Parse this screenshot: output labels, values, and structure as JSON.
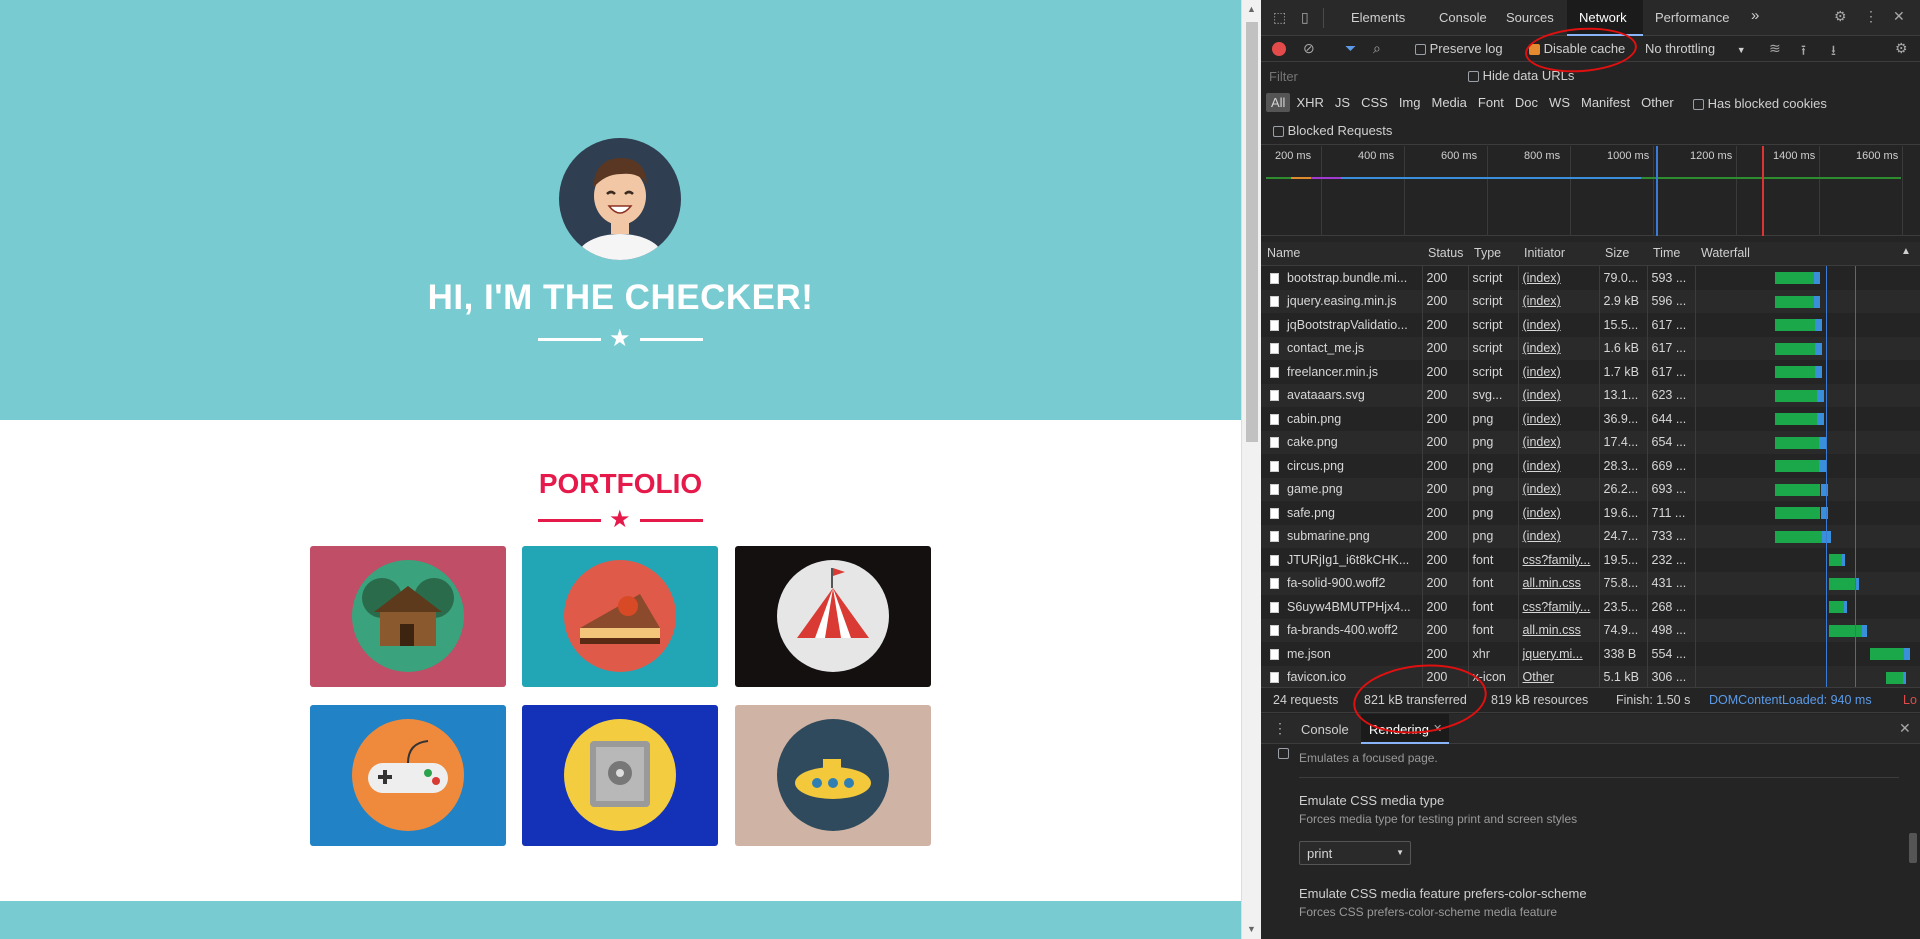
{
  "site": {
    "hero_title": "HI, I'M THE CHECKER!",
    "portfolio_title": "PORTFOLIO",
    "tiles": [
      {
        "name": "cabin",
        "bg": "#bf4e66"
      },
      {
        "name": "cake",
        "bg": "#22a5b5"
      },
      {
        "name": "circus",
        "bg": "#141010"
      },
      {
        "name": "game",
        "bg": "#2183c5"
      },
      {
        "name": "safe",
        "bg": "#1432b8"
      },
      {
        "name": "submarine",
        "bg": "#cfb3a4"
      }
    ],
    "colors": {
      "primary": "#78ccd1",
      "accent": "#e6194b"
    }
  },
  "devtools": {
    "tabs": [
      "Elements",
      "Console",
      "Sources",
      "Network",
      "Performance"
    ],
    "more_tabs": "»",
    "active_tab": "Network",
    "toolbar": {
      "preserve_log": "Preserve log",
      "disable_cache": "Disable cache",
      "throttling": "No throttling"
    },
    "filter": {
      "placeholder": "Filter",
      "hide_data_urls": "Hide data URLs",
      "types": [
        "All",
        "XHR",
        "JS",
        "CSS",
        "Img",
        "Media",
        "Font",
        "Doc",
        "WS",
        "Manifest",
        "Other"
      ],
      "has_blocked_cookies": "Has blocked cookies",
      "blocked_requests": "Blocked Requests"
    },
    "timeline_ticks": [
      "200 ms",
      "400 ms",
      "600 ms",
      "800 ms",
      "1000 ms",
      "1200 ms",
      "1400 ms",
      "1600 ms"
    ],
    "columns": [
      "Name",
      "Status",
      "Type",
      "Initiator",
      "Size",
      "Time",
      "Waterfall"
    ],
    "rows": [
      {
        "name": "bootstrap.bundle.mi...",
        "status": "200",
        "type": "script",
        "initiator": "(index)",
        "size": "79.0...",
        "time": "593 ...",
        "wf": [
          0.34,
          0.56
        ]
      },
      {
        "name": "jquery.easing.min.js",
        "status": "200",
        "type": "script",
        "initiator": "(index)",
        "size": "2.9 kB",
        "time": "596 ...",
        "wf": [
          0.34,
          0.56
        ]
      },
      {
        "name": "jqBootstrapValidatio...",
        "status": "200",
        "type": "script",
        "initiator": "(index)",
        "size": "15.5...",
        "time": "617 ...",
        "wf": [
          0.34,
          0.57
        ]
      },
      {
        "name": "contact_me.js",
        "status": "200",
        "type": "script",
        "initiator": "(index)",
        "size": "1.6 kB",
        "time": "617 ...",
        "wf": [
          0.34,
          0.57
        ]
      },
      {
        "name": "freelancer.min.js",
        "status": "200",
        "type": "script",
        "initiator": "(index)",
        "size": "1.7 kB",
        "time": "617 ...",
        "wf": [
          0.34,
          0.57
        ]
      },
      {
        "name": "avataaars.svg",
        "status": "200",
        "type": "svg...",
        "initiator": "(index)",
        "size": "13.1...",
        "time": "623 ...",
        "wf": [
          0.34,
          0.58
        ]
      },
      {
        "name": "cabin.png",
        "status": "200",
        "type": "png",
        "initiator": "(index)",
        "size": "36.9...",
        "time": "644 ...",
        "wf": [
          0.34,
          0.58
        ]
      },
      {
        "name": "cake.png",
        "status": "200",
        "type": "png",
        "initiator": "(index)",
        "size": "17.4...",
        "time": "654 ...",
        "wf": [
          0.34,
          0.59
        ]
      },
      {
        "name": "circus.png",
        "status": "200",
        "type": "png",
        "initiator": "(index)",
        "size": "28.3...",
        "time": "669 ...",
        "wf": [
          0.34,
          0.59
        ]
      },
      {
        "name": "game.png",
        "status": "200",
        "type": "png",
        "initiator": "(index)",
        "size": "26.2...",
        "time": "693 ...",
        "wf": [
          0.34,
          0.6
        ]
      },
      {
        "name": "safe.png",
        "status": "200",
        "type": "png",
        "initiator": "(index)",
        "size": "19.6...",
        "time": "711 ...",
        "wf": [
          0.34,
          0.6
        ]
      },
      {
        "name": "submarine.png",
        "status": "200",
        "type": "png",
        "initiator": "(index)",
        "size": "24.7...",
        "time": "733 ...",
        "wf": [
          0.34,
          0.61
        ]
      },
      {
        "name": "JTURjIg1_i6t8kCHK...",
        "status": "200",
        "type": "font",
        "initiator": "css?family...",
        "size": "19.5...",
        "time": "232 ...",
        "wf": [
          0.6,
          0.68
        ]
      },
      {
        "name": "fa-solid-900.woff2",
        "status": "200",
        "type": "font",
        "initiator": "all.min.css",
        "size": "75.8...",
        "time": "431 ...",
        "wf": [
          0.6,
          0.75
        ]
      },
      {
        "name": "S6uyw4BMUTPHjx4...",
        "status": "200",
        "type": "font",
        "initiator": "css?family...",
        "size": "23.5...",
        "time": "268 ...",
        "wf": [
          0.6,
          0.69
        ]
      },
      {
        "name": "fa-brands-400.woff2",
        "status": "200",
        "type": "font",
        "initiator": "all.min.css",
        "size": "74.9...",
        "time": "498 ...",
        "wf": [
          0.6,
          0.79
        ]
      },
      {
        "name": "me.json",
        "status": "200",
        "type": "xhr",
        "initiator": "jquery.mi...",
        "size": "338 B",
        "time": "554 ...",
        "wf": [
          0.8,
          1.0
        ]
      },
      {
        "name": "favicon.ico",
        "status": "200",
        "type": "x-icon",
        "initiator": "Other",
        "size": "5.1 kB",
        "time": "306 ...",
        "wf": [
          0.88,
          0.98
        ]
      }
    ],
    "summary": {
      "requests": "24 requests",
      "transferred": "821 kB transferred",
      "resources": "819 kB resources",
      "finish": "Finish: 1.50 s",
      "dcl": "DOMContentLoaded: 940 ms",
      "load": "Lo"
    },
    "drawer": {
      "tabs": [
        "Console",
        "Rendering"
      ],
      "active": "Rendering",
      "focused_desc": "Emulates a focused page.",
      "media_title": "Emulate CSS media type",
      "media_desc": "Forces media type for testing print and screen styles",
      "media_value": "print",
      "scheme_title": "Emulate CSS media feature prefers-color-scheme",
      "scheme_desc": "Forces CSS prefers-color-scheme media feature"
    }
  }
}
